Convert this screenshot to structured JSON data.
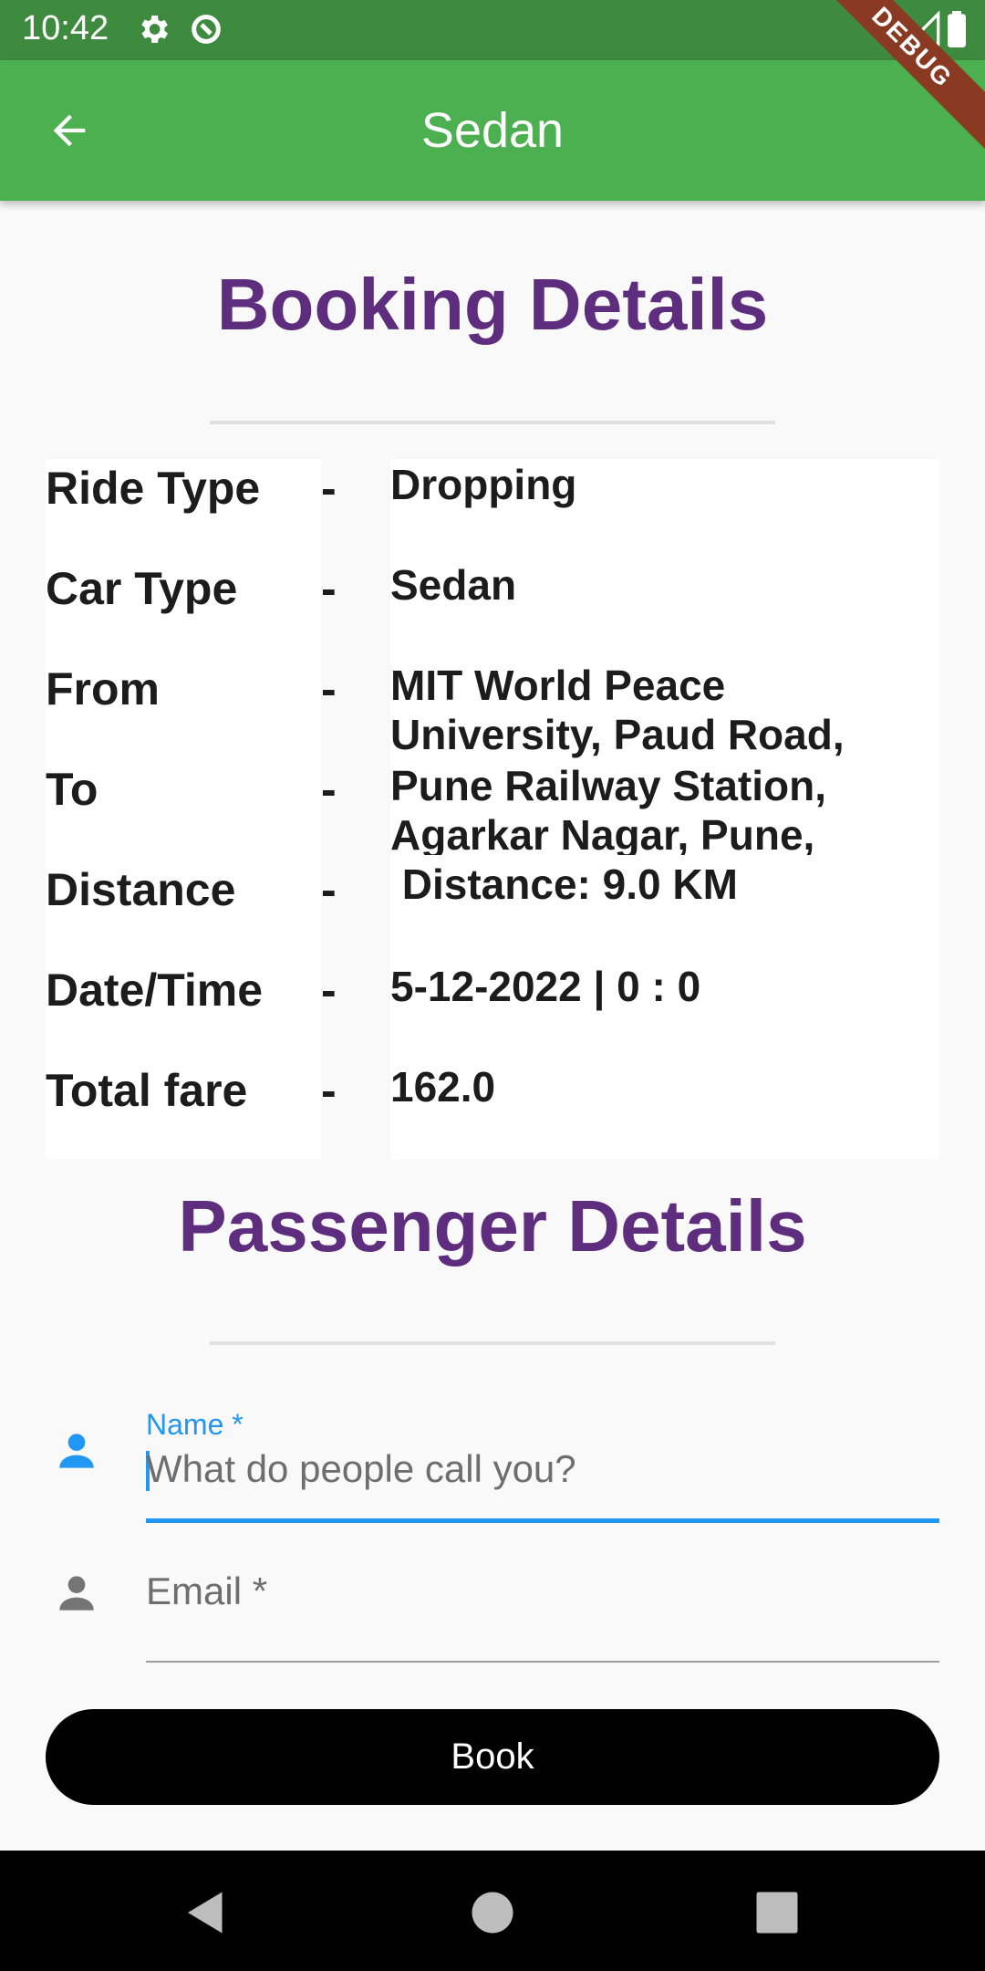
{
  "status_bar": {
    "time": "10:42",
    "debug_label": "DEBUG"
  },
  "app_bar": {
    "title": "Sedan",
    "back_icon": "arrow-back-icon"
  },
  "booking": {
    "title": "Booking Details",
    "rows": [
      {
        "label": "Ride Type",
        "separator": "-",
        "value": "Dropping"
      },
      {
        "label": "Car Type",
        "separator": "-",
        "value": "Sedan"
      },
      {
        "label": "From",
        "separator": "-",
        "value": "MIT World Peace University, Paud Road,"
      },
      {
        "label": "To",
        "separator": "-",
        "value": "Pune Railway Station, Agarkar Nagar, Pune,"
      },
      {
        "label": "Distance",
        "separator": "-",
        "value": " Distance: 9.0 KM"
      },
      {
        "label": "Date/Time",
        "separator": "-",
        "value": "5-12-2022 | 0 : 0"
      },
      {
        "label": "Total fare",
        "separator": "-",
        "value": "162.0"
      }
    ]
  },
  "passenger": {
    "title": "Passenger Details",
    "name_field": {
      "label": "Name *",
      "placeholder": "What do people call you?",
      "value": ""
    },
    "email_field": {
      "label": "Email *",
      "value": ""
    }
  },
  "book_button": {
    "label": "Book"
  },
  "colors": {
    "app_bar": "#4caf50",
    "title": "#5e2d7e",
    "focus": "#2196f3"
  }
}
